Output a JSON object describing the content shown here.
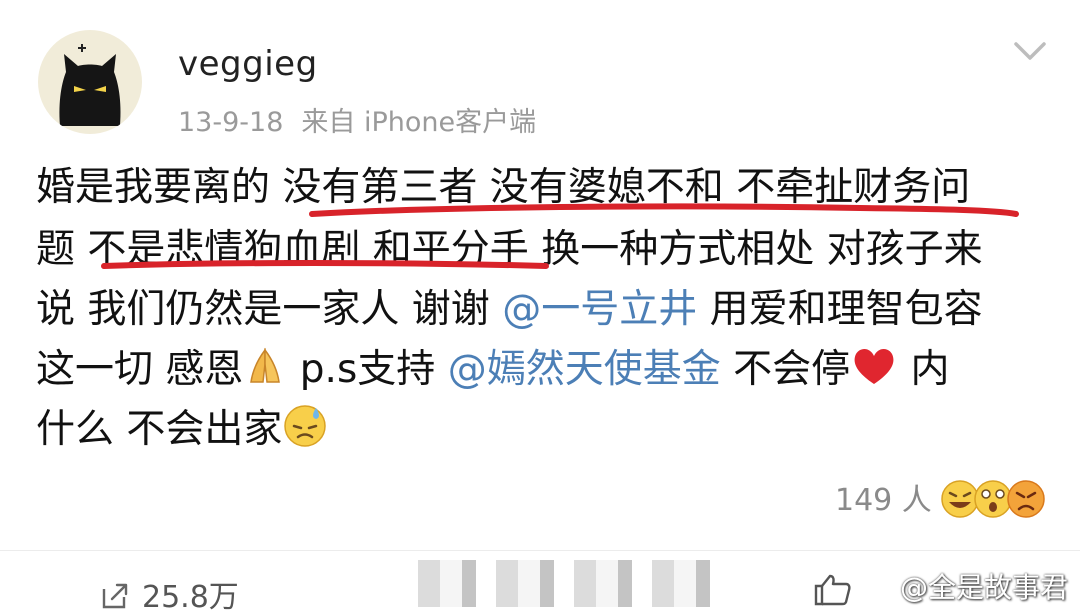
{
  "post": {
    "username": "veggieg",
    "date": "13-9-18",
    "source": "来自 iPhone客户端",
    "lines": {
      "l1": "婚是我要离的 没有第三者 没有婆媳不和 不牵扯财务问",
      "l2": "题 不是悲情狗血剧 和平分手 换一种方式相处 对孩子来",
      "l3_a": "说 我们仍然是一家人 谢谢 ",
      "l3_mention": "@一号立井",
      "l3_b": " 用爱和理智包容",
      "l4_a": "这一切 感恩",
      "l4_b": " p.s支持 ",
      "l4_mention": "@嫣然天使基金",
      "l4_c": " 不会停",
      "l4_d": " 内",
      "l5": "什么 不会出家"
    }
  },
  "reactions": {
    "count": "149 人"
  },
  "footer": {
    "share_count": "25.8万",
    "watermark": "@全是故事君"
  },
  "colors": {
    "mention": "#4c7fb6",
    "underline": "#d8232a",
    "meta": "#9a9a9a"
  },
  "icons": [
    "cat-avatar",
    "chevron-down-icon",
    "pray-emoji",
    "heart-emoji",
    "sweat-emoji",
    "reaction-laugh-icon",
    "reaction-surprise-icon",
    "reaction-angry-icon",
    "share-icon",
    "like-icon"
  ]
}
